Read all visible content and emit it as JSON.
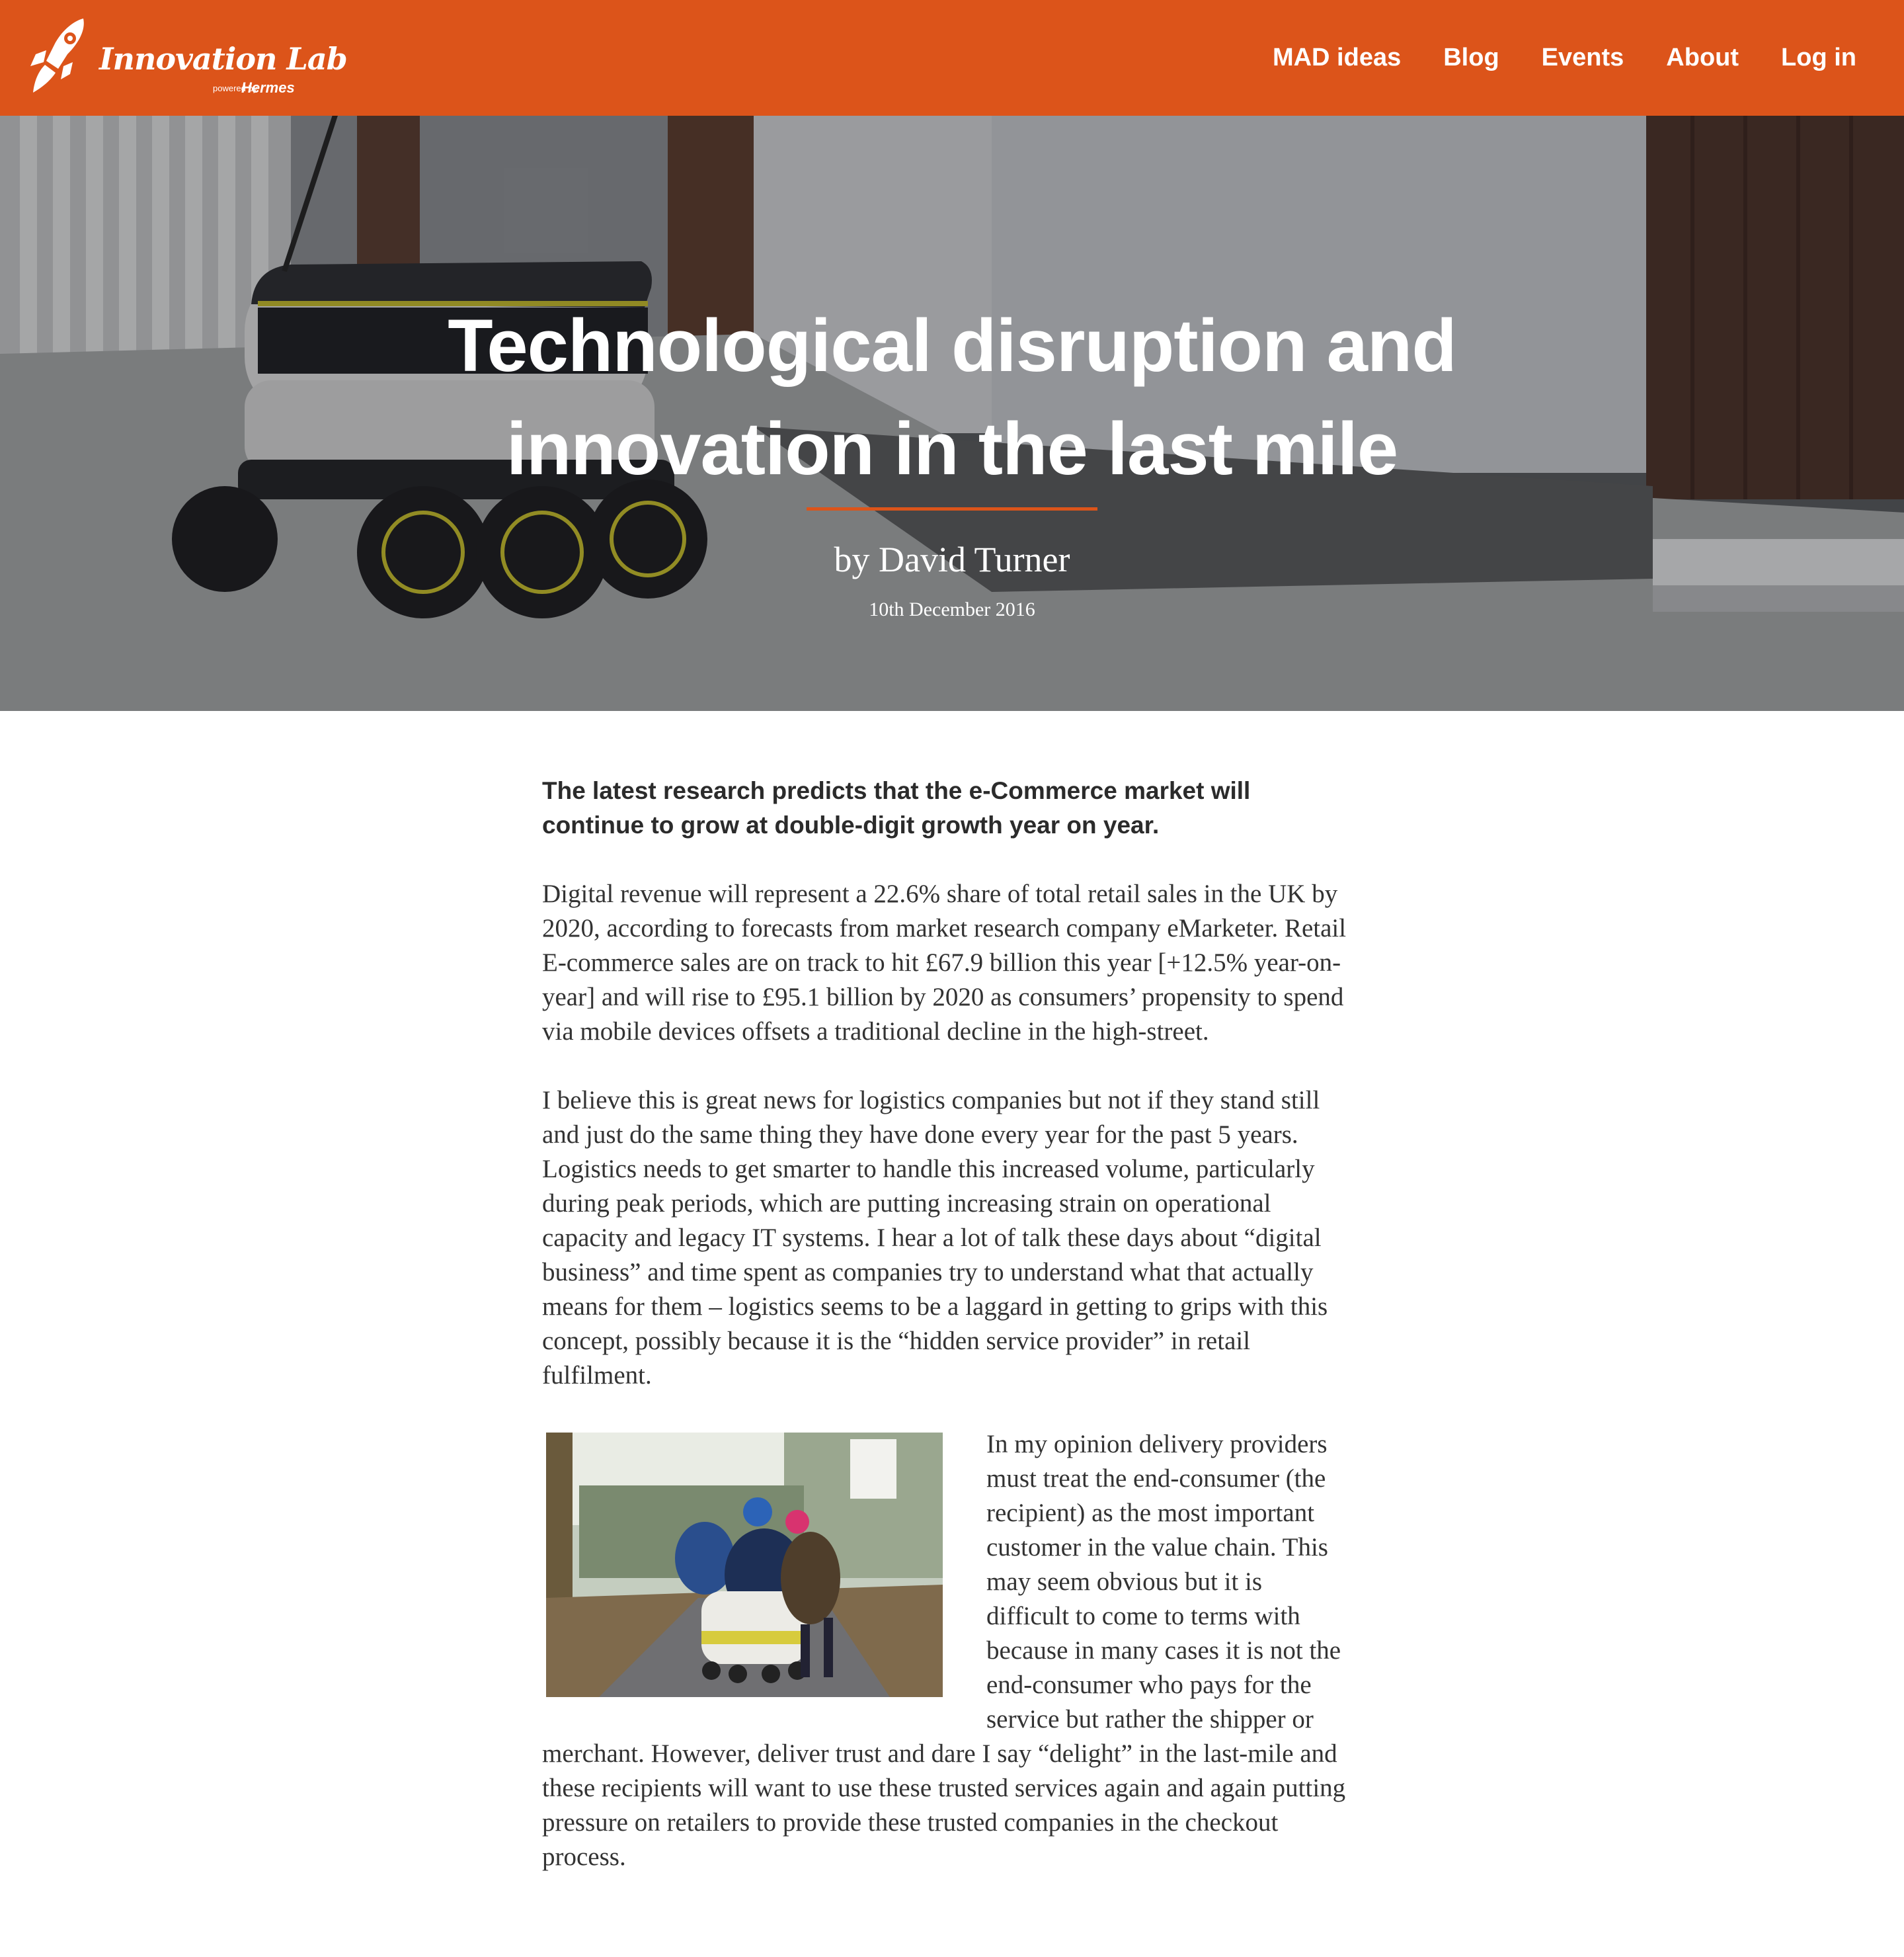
{
  "header": {
    "logo": {
      "name": "Innovation Lab",
      "powered_by": "powered by",
      "brand": "Hermes"
    },
    "nav": [
      "MAD ideas",
      "Blog",
      "Events",
      "About",
      "Log in"
    ],
    "accent_color": "#dc541a"
  },
  "hero": {
    "title": "Technological disruption and innovation in the last mile",
    "author": "by David Turner",
    "date": "10th December 2016",
    "image": "delivery-robot-photo"
  },
  "article": {
    "lead": "The latest research predicts that the e-Commerce market will continue to grow at double-digit growth year on year.",
    "paragraphs": [
      "Digital revenue will represent a 22.6% share of total retail sales in the UK by 2020, according to forecasts from market research company eMarketer. Retail E-commerce sales are on track to hit £67.9 billion this year [+12.5% year-on-year] and will rise to £95.1 billion by 2020 as consumers’ propensity to spend via mobile devices offsets a traditional decline in the high-street.",
      "I believe this is great news for logistics companies but not if they stand still and just do the same thing they have done every year for the past 5 years. Logistics needs to get smarter to handle this increased volume, particularly during peak periods, which are putting increasing strain on operational capacity and legacy IT systems. I hear a lot of talk these days about “digital business” and time spent as companies try to understand what that actually means for them – logistics seems to be a laggard in getting to grips with this concept, possibly because it is the “hidden service provider” in retail fulfilment.",
      "In my opinion delivery providers must treat the end-consumer (the recipient) as the most important customer in the value chain. This may seem obvious but it is difficult to come to terms with because in many cases it is not the end-consumer who pays for the service but rather the shipper or merchant. However, deliver trust and dare I say “delight” in the last-mile and these recipients will want to use these trusted services again and again putting pressure on retailers to provide these trusted companies in the checkout process."
    ],
    "figure": "children-with-delivery-robot-photo"
  }
}
